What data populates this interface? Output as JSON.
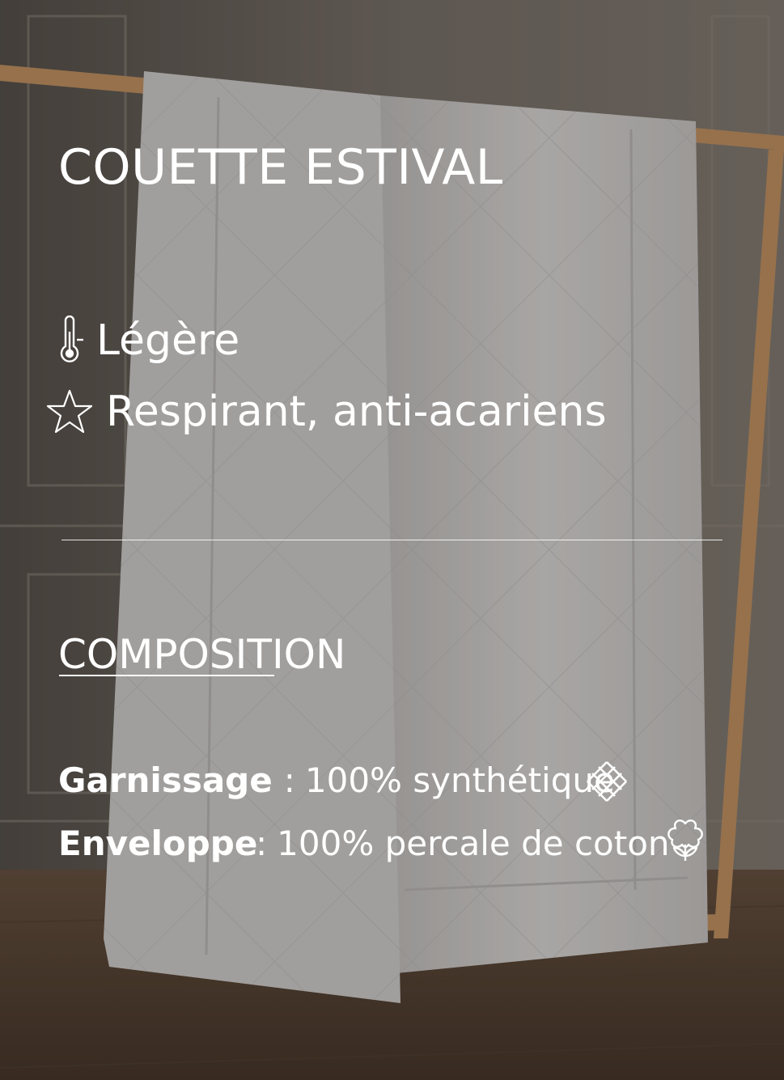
{
  "title": "COUETTE ESTIVAL",
  "features": [
    {
      "icon": "thermometer-icon",
      "label": "Légère"
    },
    {
      "icon": "star-icon",
      "label": "Respirant, anti-acariens"
    }
  ],
  "composition": {
    "heading": "COMPOSITION",
    "rows": [
      {
        "label": "Garnissage",
        "separator": ":",
        "value": "100% synthétique",
        "icon": "woven-fiber-icon"
      },
      {
        "label": "Enveloppe",
        "separator": ":",
        "value": "100% percale de coton",
        "icon": "cotton-flower-icon"
      }
    ]
  },
  "colors": {
    "text": "#ffffff",
    "wall": "#6b645e",
    "duvet": "#c9c7c6",
    "wood": "#b88a5b"
  }
}
